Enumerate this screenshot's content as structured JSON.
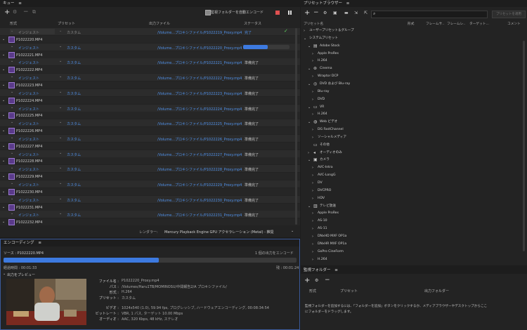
{
  "queue": {
    "title": "キュー",
    "auto_encode_label": "監視フォルダーを自動エンコード",
    "columns": {
      "format": "形式",
      "preset": "プリセット",
      "output": "出力ファイル",
      "status": "ステータス"
    },
    "rows": [
      {
        "format": "インジェスト",
        "preset": "カスタム",
        "output": "/Volume...プロキシファイル/P1022219_Proxy.mp4",
        "status": "完了",
        "clip": "",
        "state": "done"
      },
      {
        "format": "",
        "preset": "",
        "output": "",
        "status": "",
        "clip": "P1022220.MP4",
        "state": "header"
      },
      {
        "format": "インジェスト",
        "preset": "カスタム",
        "output": "/Volume...プロキシファイル/P1022220_Proxy.mp4",
        "status": "",
        "clip": "",
        "state": "progress"
      },
      {
        "format": "",
        "preset": "",
        "output": "",
        "status": "",
        "clip": "P1022221.MP4",
        "state": "header"
      },
      {
        "format": "インジェスト",
        "preset": "カスタム",
        "output": "/Volume...プロキシファイル/P1022221_Proxy.mp4",
        "status": "準備完了",
        "clip": "",
        "state": "ready"
      },
      {
        "format": "",
        "preset": "",
        "output": "",
        "status": "",
        "clip": "P1022222.MP4",
        "state": "header"
      },
      {
        "format": "インジェスト",
        "preset": "カスタム",
        "output": "/Volume...プロキシファイル/P1022222_Proxy.mp4",
        "status": "準備完了",
        "clip": "",
        "state": "ready"
      },
      {
        "format": "",
        "preset": "",
        "output": "",
        "status": "",
        "clip": "P1022223.MP4",
        "state": "header"
      },
      {
        "format": "インジェスト",
        "preset": "カスタム",
        "output": "/Volume...プロキシファイル/P1022223_Proxy.mp4",
        "status": "準備完了",
        "clip": "",
        "state": "ready"
      },
      {
        "format": "",
        "preset": "",
        "output": "",
        "status": "",
        "clip": "P1022224.MP4",
        "state": "header"
      },
      {
        "format": "インジェスト",
        "preset": "カスタム",
        "output": "/Volume...プロキシファイル/P1022224_Proxy.mp4",
        "status": "準備完了",
        "clip": "",
        "state": "ready"
      },
      {
        "format": "",
        "preset": "",
        "output": "",
        "status": "",
        "clip": "P1022225.MP4",
        "state": "header"
      },
      {
        "format": "インジェスト",
        "preset": "カスタム",
        "output": "/Volume...プロキシファイル/P1022225_Proxy.mp4",
        "status": "準備完了",
        "clip": "",
        "state": "ready"
      },
      {
        "format": "",
        "preset": "",
        "output": "",
        "status": "",
        "clip": "P1022226.MP4",
        "state": "header"
      },
      {
        "format": "インジェスト",
        "preset": "カスタム",
        "output": "/Volume...プロキシファイル/P1022226_Proxy.mp4",
        "status": "準備完了",
        "clip": "",
        "state": "ready"
      },
      {
        "format": "",
        "preset": "",
        "output": "",
        "status": "",
        "clip": "P1022227.MP4",
        "state": "header"
      },
      {
        "format": "インジェスト",
        "preset": "カスタム",
        "output": "/Volume...プロキシファイル/P1022227_Proxy.mp4",
        "status": "準備完了",
        "clip": "",
        "state": "ready"
      },
      {
        "format": "",
        "preset": "",
        "output": "",
        "status": "",
        "clip": "P1022228.MP4",
        "state": "header"
      },
      {
        "format": "インジェスト",
        "preset": "カスタム",
        "output": "/Volume...プロキシファイル/P1022228_Proxy.mp4",
        "status": "準備完了",
        "clip": "",
        "state": "ready"
      },
      {
        "format": "",
        "preset": "",
        "output": "",
        "status": "",
        "clip": "P1022229.MP4",
        "state": "header"
      },
      {
        "format": "インジェスト",
        "preset": "カスタム",
        "output": "/Volume...プロキシファイル/P1022229_Proxy.mp4",
        "status": "準備完了",
        "clip": "",
        "state": "ready"
      },
      {
        "format": "",
        "preset": "",
        "output": "",
        "status": "",
        "clip": "P1022230.MP4",
        "state": "header"
      },
      {
        "format": "インジェスト",
        "preset": "カスタム",
        "output": "/Volume...プロキシファイル/P1022230_Proxy.mp4",
        "status": "準備完了",
        "clip": "",
        "state": "ready"
      },
      {
        "format": "",
        "preset": "",
        "output": "",
        "status": "",
        "clip": "P1022231.MP4",
        "state": "header"
      },
      {
        "format": "インジェスト",
        "preset": "カスタム",
        "output": "/Volume...プロキシファイル/P1022231_Proxy.mp4",
        "status": "準備完了",
        "clip": "",
        "state": "ready"
      },
      {
        "format": "",
        "preset": "",
        "output": "",
        "status": "",
        "clip": "P1022232.MP4",
        "state": "header"
      }
    ],
    "renderer_label": "レンダラー:",
    "renderer_value": "Mercury Playback Engine GPU アクセラレーション (Metal) - 推奨"
  },
  "encoding": {
    "title": "エンコーディング",
    "source_label": "ソース : P1022220.MP4",
    "outputs_count": "1 個の出力をエンコード",
    "progress": 0.53,
    "elapsed": "経過時間 : 00:01:33",
    "remaining": "残 : 00:01:24",
    "preview_label": "出力をプレビュー",
    "info": [
      {
        "label": "ファイル名 :",
        "value": "P1022220_Proxy.mp4"
      },
      {
        "label": "パス :",
        "value": "/Volumes/Haru1TB/MOMINOSU/中間報告2/A プロキシファイル/"
      },
      {
        "label": "形式 :",
        "value": "H.264"
      },
      {
        "label": "プリセット :",
        "value": "カスタム"
      },
      {
        "label": "ビデオ :",
        "value": "1024x540 (1.0), 59.94 fps, プログレッシブ, ハードウェアエンコーディング, 00:08:34:54"
      },
      {
        "label": "ビットレート :",
        "value": "VBR, 1 パス, ターゲット 10.00 Mbps"
      },
      {
        "label": "オーディオ :",
        "value": "AAC, 320 Kbps, 48 kHz, ステレオ"
      }
    ]
  },
  "preset_browser": {
    "title": "プリセットブラウザー",
    "apply_button": "プリセットを適用",
    "columns": {
      "name": "プリセット名",
      "format": "形式",
      "frame": "フレームサ..",
      "framerate": "フレームレ..",
      "target": "ターゲット...",
      "comment": "コメント"
    },
    "items": [
      {
        "label": "ユーザープリセット＆グループ",
        "level": 0,
        "icon": "",
        "expanded": "closed"
      },
      {
        "label": "システムプリセット",
        "level": 0,
        "icon": "",
        "expanded": "open"
      },
      {
        "label": "Adobe Stock",
        "level": 1,
        "icon": "stock",
        "expanded": "open"
      },
      {
        "label": "Apple ProRes",
        "level": 2,
        "icon": "",
        "expanded": "closed"
      },
      {
        "label": "H.264",
        "level": 2,
        "icon": "",
        "expanded": "closed"
      },
      {
        "label": "Cinema",
        "level": 1,
        "icon": "cinema",
        "expanded": "open"
      },
      {
        "label": "Wraptor DCP",
        "level": 2,
        "icon": "",
        "expanded": "closed"
      },
      {
        "label": "DVD および Blu-ray",
        "level": 1,
        "icon": "disc",
        "expanded": "open"
      },
      {
        "label": "Blu-ray",
        "level": 2,
        "icon": "",
        "expanded": "closed"
      },
      {
        "label": "DVD",
        "level": 2,
        "icon": "",
        "expanded": "closed"
      },
      {
        "label": "VR",
        "level": 1,
        "icon": "vr",
        "expanded": "open"
      },
      {
        "label": "H.264",
        "level": 2,
        "icon": "",
        "expanded": "closed"
      },
      {
        "label": "Web ビデオ",
        "level": 1,
        "icon": "globe",
        "expanded": "open"
      },
      {
        "label": "DG FastChannel",
        "level": 2,
        "icon": "",
        "expanded": "closed"
      },
      {
        "label": "ソーシャルメディア",
        "level": 2,
        "icon": "",
        "expanded": "closed"
      },
      {
        "label": "その他",
        "level": 1,
        "icon": "monitor",
        "expanded": "none"
      },
      {
        "label": "オーディオのみ",
        "level": 1,
        "icon": "speaker",
        "expanded": "closed"
      },
      {
        "label": "カメラ",
        "level": 1,
        "icon": "camera",
        "expanded": "open"
      },
      {
        "label": "AVC-Intra",
        "level": 2,
        "icon": "",
        "expanded": "closed"
      },
      {
        "label": "AVC-LongG",
        "level": 2,
        "icon": "",
        "expanded": "closed"
      },
      {
        "label": "DV",
        "level": 2,
        "icon": "",
        "expanded": "closed"
      },
      {
        "label": "DVCPRO",
        "level": 2,
        "icon": "",
        "expanded": "closed"
      },
      {
        "label": "HDV",
        "level": 2,
        "icon": "",
        "expanded": "closed"
      },
      {
        "label": "テレビ放送",
        "level": 1,
        "icon": "tv",
        "expanded": "open"
      },
      {
        "label": "Apple ProRes",
        "level": 2,
        "icon": "",
        "expanded": "closed"
      },
      {
        "label": "AS-10",
        "level": 2,
        "icon": "",
        "expanded": "closed"
      },
      {
        "label": "AS-11",
        "level": 2,
        "icon": "",
        "expanded": "closed"
      },
      {
        "label": "DNxHD MXF OP1a",
        "level": 2,
        "icon": "",
        "expanded": "closed"
      },
      {
        "label": "DNxHR MXF OP1a",
        "level": 2,
        "icon": "",
        "expanded": "closed"
      },
      {
        "label": "GoPro CineForm",
        "level": 2,
        "icon": "",
        "expanded": "closed"
      },
      {
        "label": "H.264",
        "level": 2,
        "icon": "",
        "expanded": "closed"
      }
    ]
  },
  "watch_folder": {
    "title": "監視フォルダー",
    "columns": {
      "format": "形式",
      "preset": "プリセット",
      "output": "出力フォルダー"
    },
    "empty_message_1": "監視フォルダーを追加するには、「フォルダーを追加」ボタンをクリックするか、メディアブラウザーやデスクトップからここ",
    "empty_message_2": "にフォルダーをドラッグします。"
  },
  "colors": {
    "accent": "#3d7ae0",
    "link": "#4f8fe6",
    "check": "#5fd35f",
    "stop": "#e05050"
  }
}
